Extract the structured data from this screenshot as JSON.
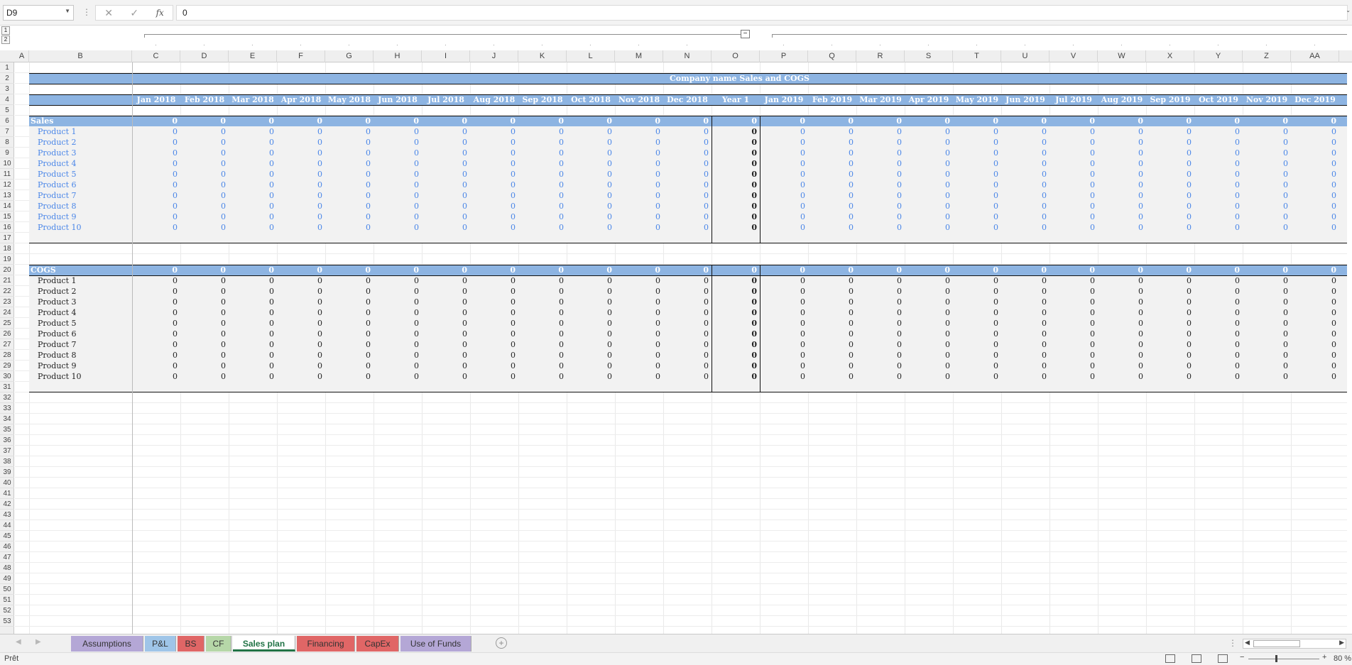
{
  "formula_bar": {
    "name_box": "D9",
    "cancel_glyph": "✕",
    "enter_glyph": "✓",
    "fx_label": "fx",
    "formula_value": "0",
    "expand_glyph": "⌄"
  },
  "outline": {
    "levels": [
      "1",
      "2"
    ],
    "collapse_glyph": "−"
  },
  "columns": [
    "A",
    "B",
    "C",
    "D",
    "E",
    "F",
    "G",
    "H",
    "I",
    "J",
    "K",
    "L",
    "M",
    "N",
    "O",
    "P",
    "Q",
    "R",
    "S",
    "T",
    "U",
    "V",
    "W",
    "X",
    "Y",
    "Z",
    "AA"
  ],
  "rows": [
    "1",
    "2",
    "3",
    "4",
    "5",
    "6",
    "7",
    "8",
    "9",
    "10",
    "11",
    "12",
    "13",
    "14",
    "15",
    "16",
    "17",
    "18",
    "19",
    "20",
    "21",
    "22",
    "23",
    "24",
    "25",
    "26",
    "27",
    "28",
    "29",
    "30",
    "31",
    "32",
    "33",
    "34",
    "35",
    "36",
    "37",
    "38",
    "39",
    "40",
    "41",
    "42",
    "43",
    "44",
    "45",
    "46",
    "47",
    "48",
    "49",
    "50",
    "51",
    "52",
    "53"
  ],
  "sheet": {
    "title": "Company name Sales and COGS",
    "months": [
      "Jan 2018",
      "Feb 2018",
      "Mar 2018",
      "Apr 2018",
      "May 2018",
      "Jun 2018",
      "Jul 2018",
      "Aug 2018",
      "Sep 2018",
      "Oct 2018",
      "Nov 2018",
      "Dec 2018",
      "Year 1",
      "Jan 2019",
      "Feb 2019",
      "Mar 2019",
      "Apr 2019",
      "May 2019",
      "Jun 2019",
      "Jul 2019",
      "Aug 2019",
      "Sep 2019",
      "Oct 2019",
      "Nov 2019",
      "Dec 2019"
    ],
    "sales_label": "Sales",
    "cogs_label": "COGS",
    "products": [
      "Product 1",
      "Product 2",
      "Product 3",
      "Product 4",
      "Product 5",
      "Product 6",
      "Product 7",
      "Product 8",
      "Product 9",
      "Product 10"
    ],
    "zero": "0"
  },
  "tabs": [
    {
      "label": "Assumptions",
      "color": "#b4a7d6",
      "active": false
    },
    {
      "label": "P&L",
      "color": "#9fc5e8",
      "active": false
    },
    {
      "label": "BS",
      "color": "#e06666",
      "active": false
    },
    {
      "label": "CF",
      "color": "#b6d7a8",
      "active": false
    },
    {
      "label": "Sales plan",
      "color": "#ffffff",
      "active": true
    },
    {
      "label": "Financing",
      "color": "#e06666",
      "active": false
    },
    {
      "label": "CapEx",
      "color": "#e06666",
      "active": false
    },
    {
      "label": "Use of Funds",
      "color": "#b4a7d6",
      "active": false
    }
  ],
  "status": {
    "text": "Prêt",
    "zoom": "80 %",
    "zoom_fraction": 0.38
  },
  "colors": {
    "header_band": "#8db4e2",
    "input_blue": "#4a86e8",
    "active_tab": "#217346"
  }
}
